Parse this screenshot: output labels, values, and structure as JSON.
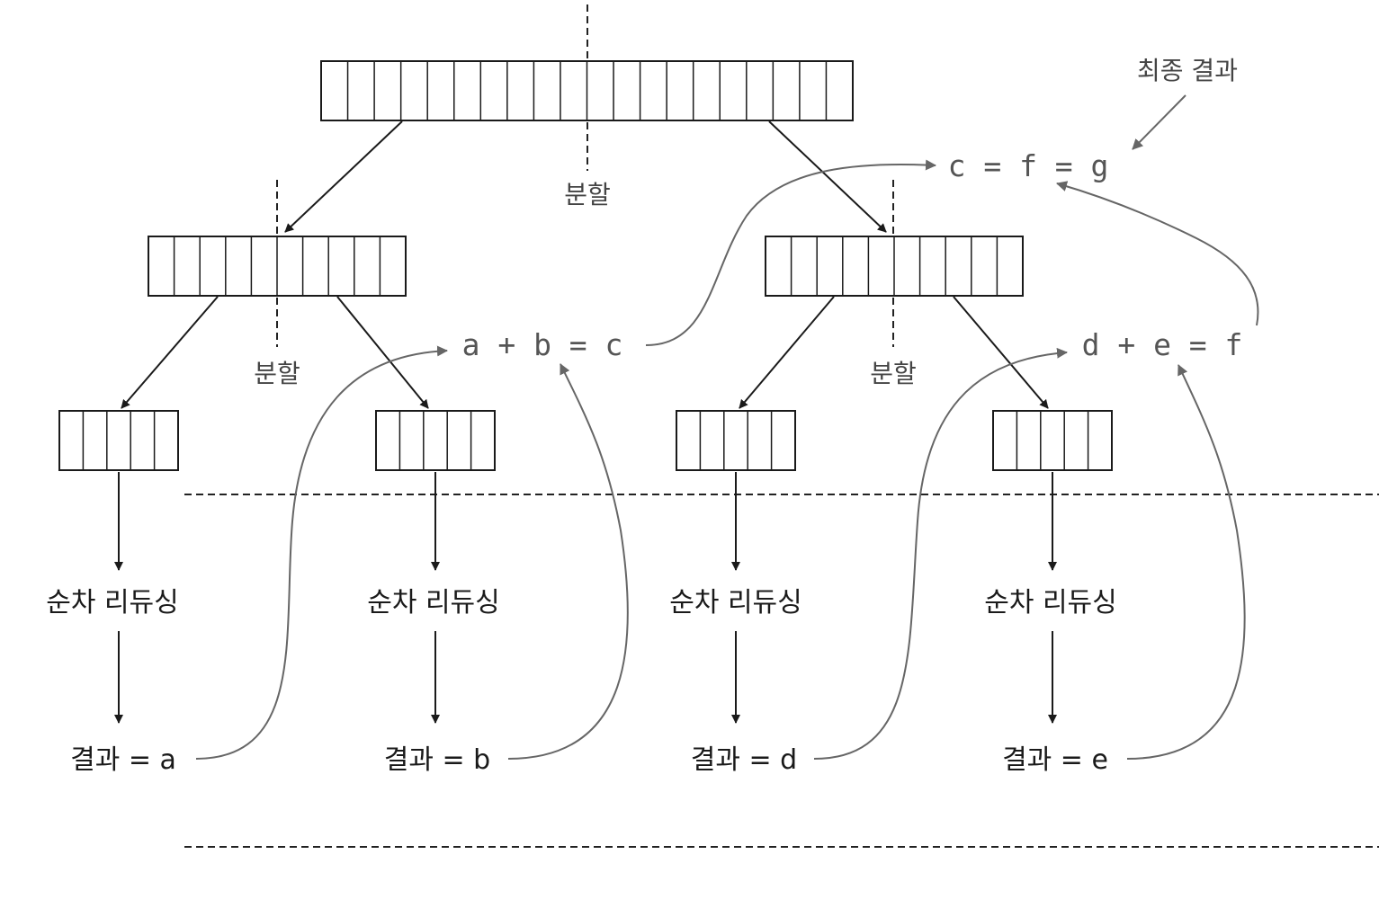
{
  "labels": {
    "split": "분할",
    "sequential_reduce": "순차 리듀싱",
    "final_result": "최종 결과"
  },
  "equations": {
    "ab": "a + b = c",
    "de": "d + e = f",
    "cfg": "c = f = g"
  },
  "leaf_results": [
    {
      "name": "result-a",
      "text": "결과 = a"
    },
    {
      "name": "result-b",
      "text": "결과 = b"
    },
    {
      "name": "result-d",
      "text": "결과 = d"
    },
    {
      "name": "result-e",
      "text": "결과 = e"
    }
  ],
  "arrays": {
    "root_cells": 20,
    "mid_cells": 10,
    "leaf_cells": 5
  },
  "colors": {
    "line_dark": "#1a1a1a",
    "line_gray": "#666666"
  }
}
